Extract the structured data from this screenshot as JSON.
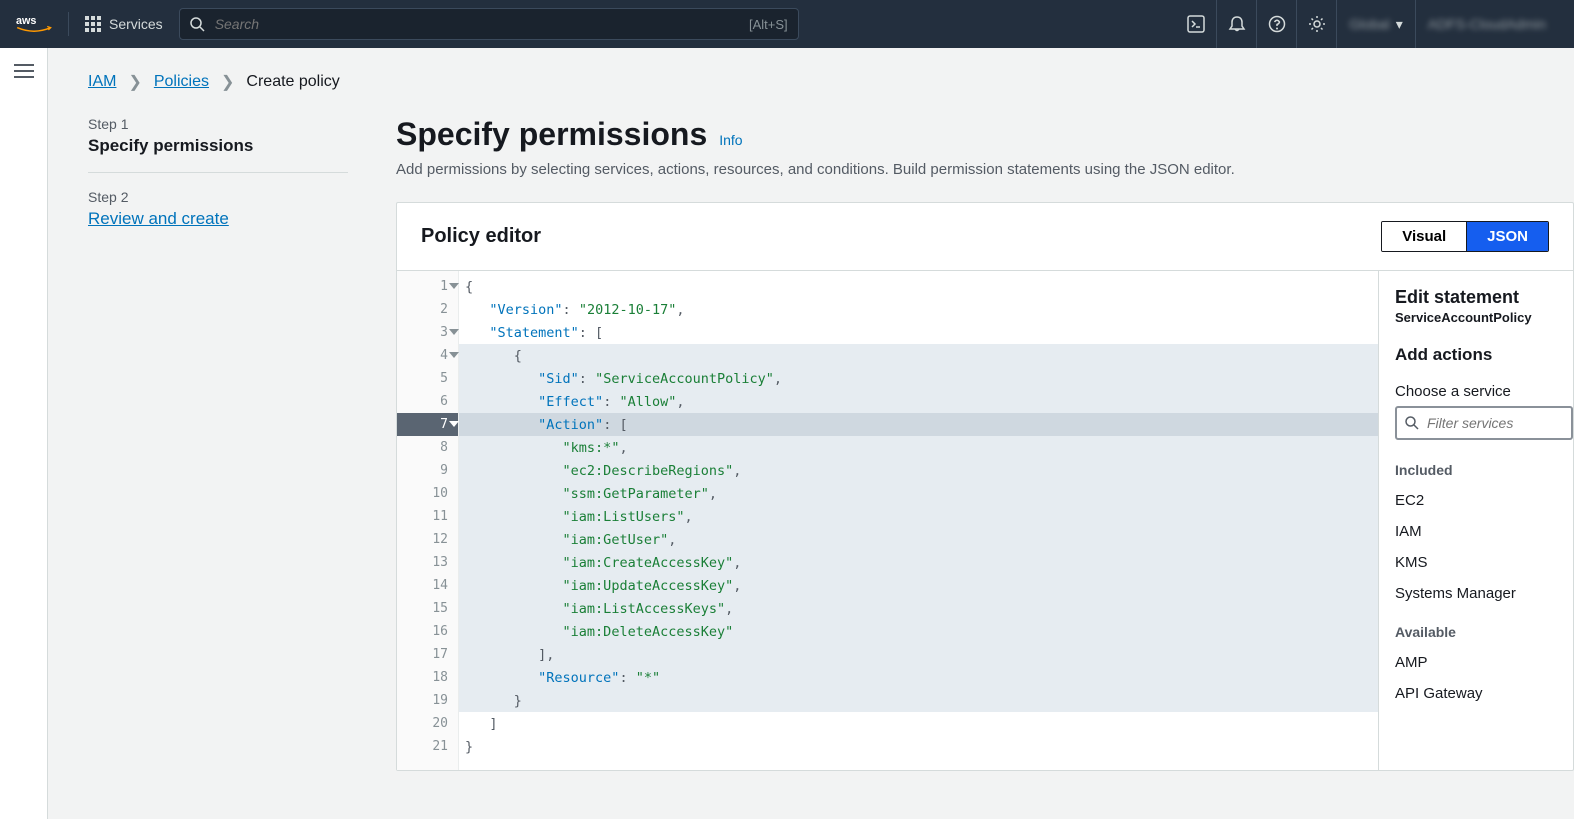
{
  "topnav": {
    "services": "Services",
    "search_placeholder": "Search",
    "search_shortcut": "[Alt+S]",
    "region": "Global",
    "account": "ADFS-CloudAdmin"
  },
  "crumbs": {
    "iam": "IAM",
    "policies": "Policies",
    "create": "Create policy"
  },
  "stepper": {
    "step1_label": "Step 1",
    "step1_title": "Specify permissions",
    "step2_label": "Step 2",
    "step2_title": "Review and create"
  },
  "main": {
    "title": "Specify permissions",
    "info": "Info",
    "desc": "Add permissions by selecting services, actions, resources, and conditions. Build permission statements using the JSON editor.",
    "panel_title": "Policy editor",
    "seg_visual": "Visual",
    "seg_json": "JSON"
  },
  "code": {
    "lines": [
      {
        "n": 1,
        "fold": true,
        "hl": false,
        "segs": [
          [
            "punc",
            "{"
          ]
        ]
      },
      {
        "n": 2,
        "fold": false,
        "hl": false,
        "segs": [
          [
            "pad",
            "   "
          ],
          [
            "key",
            "\"Version\""
          ],
          [
            "punc",
            ": "
          ],
          [
            "str",
            "\"2012-10-17\""
          ],
          [
            "punc",
            ","
          ]
        ]
      },
      {
        "n": 3,
        "fold": true,
        "hl": false,
        "segs": [
          [
            "pad",
            "   "
          ],
          [
            "key",
            "\"Statement\""
          ],
          [
            "punc",
            ": ["
          ]
        ]
      },
      {
        "n": 4,
        "fold": true,
        "hl": true,
        "segs": [
          [
            "pad",
            "      "
          ],
          [
            "punc",
            "{"
          ]
        ]
      },
      {
        "n": 5,
        "fold": false,
        "hl": true,
        "segs": [
          [
            "pad",
            "         "
          ],
          [
            "key",
            "\"Sid\""
          ],
          [
            "punc",
            ": "
          ],
          [
            "str",
            "\"ServiceAccountPolicy\""
          ],
          [
            "punc",
            ","
          ]
        ]
      },
      {
        "n": 6,
        "fold": false,
        "hl": true,
        "segs": [
          [
            "pad",
            "         "
          ],
          [
            "key",
            "\"Effect\""
          ],
          [
            "punc",
            ": "
          ],
          [
            "str",
            "\"Allow\""
          ],
          [
            "punc",
            ","
          ]
        ]
      },
      {
        "n": 7,
        "fold": true,
        "hl": true,
        "active": true,
        "segs": [
          [
            "pad",
            "         "
          ],
          [
            "key",
            "\"Action\""
          ],
          [
            "punc",
            ": ["
          ]
        ]
      },
      {
        "n": 8,
        "fold": false,
        "hl": true,
        "segs": [
          [
            "pad",
            "            "
          ],
          [
            "str",
            "\"kms:*\""
          ],
          [
            "punc",
            ","
          ]
        ]
      },
      {
        "n": 9,
        "fold": false,
        "hl": true,
        "segs": [
          [
            "pad",
            "            "
          ],
          [
            "str",
            "\"ec2:DescribeRegions\""
          ],
          [
            "punc",
            ","
          ]
        ]
      },
      {
        "n": 10,
        "fold": false,
        "hl": true,
        "segs": [
          [
            "pad",
            "            "
          ],
          [
            "str",
            "\"ssm:GetParameter\""
          ],
          [
            "punc",
            ","
          ]
        ]
      },
      {
        "n": 11,
        "fold": false,
        "hl": true,
        "segs": [
          [
            "pad",
            "            "
          ],
          [
            "str",
            "\"iam:ListUsers\""
          ],
          [
            "punc",
            ","
          ]
        ]
      },
      {
        "n": 12,
        "fold": false,
        "hl": true,
        "segs": [
          [
            "pad",
            "            "
          ],
          [
            "str",
            "\"iam:GetUser\""
          ],
          [
            "punc",
            ","
          ]
        ]
      },
      {
        "n": 13,
        "fold": false,
        "hl": true,
        "segs": [
          [
            "pad",
            "            "
          ],
          [
            "str",
            "\"iam:CreateAccessKey\""
          ],
          [
            "punc",
            ","
          ]
        ]
      },
      {
        "n": 14,
        "fold": false,
        "hl": true,
        "segs": [
          [
            "pad",
            "            "
          ],
          [
            "str",
            "\"iam:UpdateAccessKey\""
          ],
          [
            "punc",
            ","
          ]
        ]
      },
      {
        "n": 15,
        "fold": false,
        "hl": true,
        "segs": [
          [
            "pad",
            "            "
          ],
          [
            "str",
            "\"iam:ListAccessKeys\""
          ],
          [
            "punc",
            ","
          ]
        ]
      },
      {
        "n": 16,
        "fold": false,
        "hl": true,
        "segs": [
          [
            "pad",
            "            "
          ],
          [
            "str",
            "\"iam:DeleteAccessKey\""
          ]
        ]
      },
      {
        "n": 17,
        "fold": false,
        "hl": true,
        "segs": [
          [
            "pad",
            "         "
          ],
          [
            "punc",
            "],"
          ]
        ]
      },
      {
        "n": 18,
        "fold": false,
        "hl": true,
        "segs": [
          [
            "pad",
            "         "
          ],
          [
            "key",
            "\"Resource\""
          ],
          [
            "punc",
            ": "
          ],
          [
            "str",
            "\"*\""
          ]
        ]
      },
      {
        "n": 19,
        "fold": false,
        "hl": true,
        "segs": [
          [
            "pad",
            "      "
          ],
          [
            "punc",
            "}"
          ]
        ]
      },
      {
        "n": 20,
        "fold": false,
        "hl": false,
        "segs": [
          [
            "pad",
            "   "
          ],
          [
            "punc",
            "]"
          ]
        ]
      },
      {
        "n": 21,
        "fold": false,
        "hl": false,
        "segs": [
          [
            "punc",
            "}"
          ]
        ]
      }
    ]
  },
  "right": {
    "title": "Edit statement",
    "sub": "ServiceAccountPolicy",
    "add_actions": "Add actions",
    "choose": "Choose a service",
    "filter_ph": "Filter services",
    "included_head": "Included",
    "included": [
      "EC2",
      "IAM",
      "KMS",
      "Systems Manager"
    ],
    "available_head": "Available",
    "available": [
      "AMP",
      "API Gateway"
    ]
  }
}
